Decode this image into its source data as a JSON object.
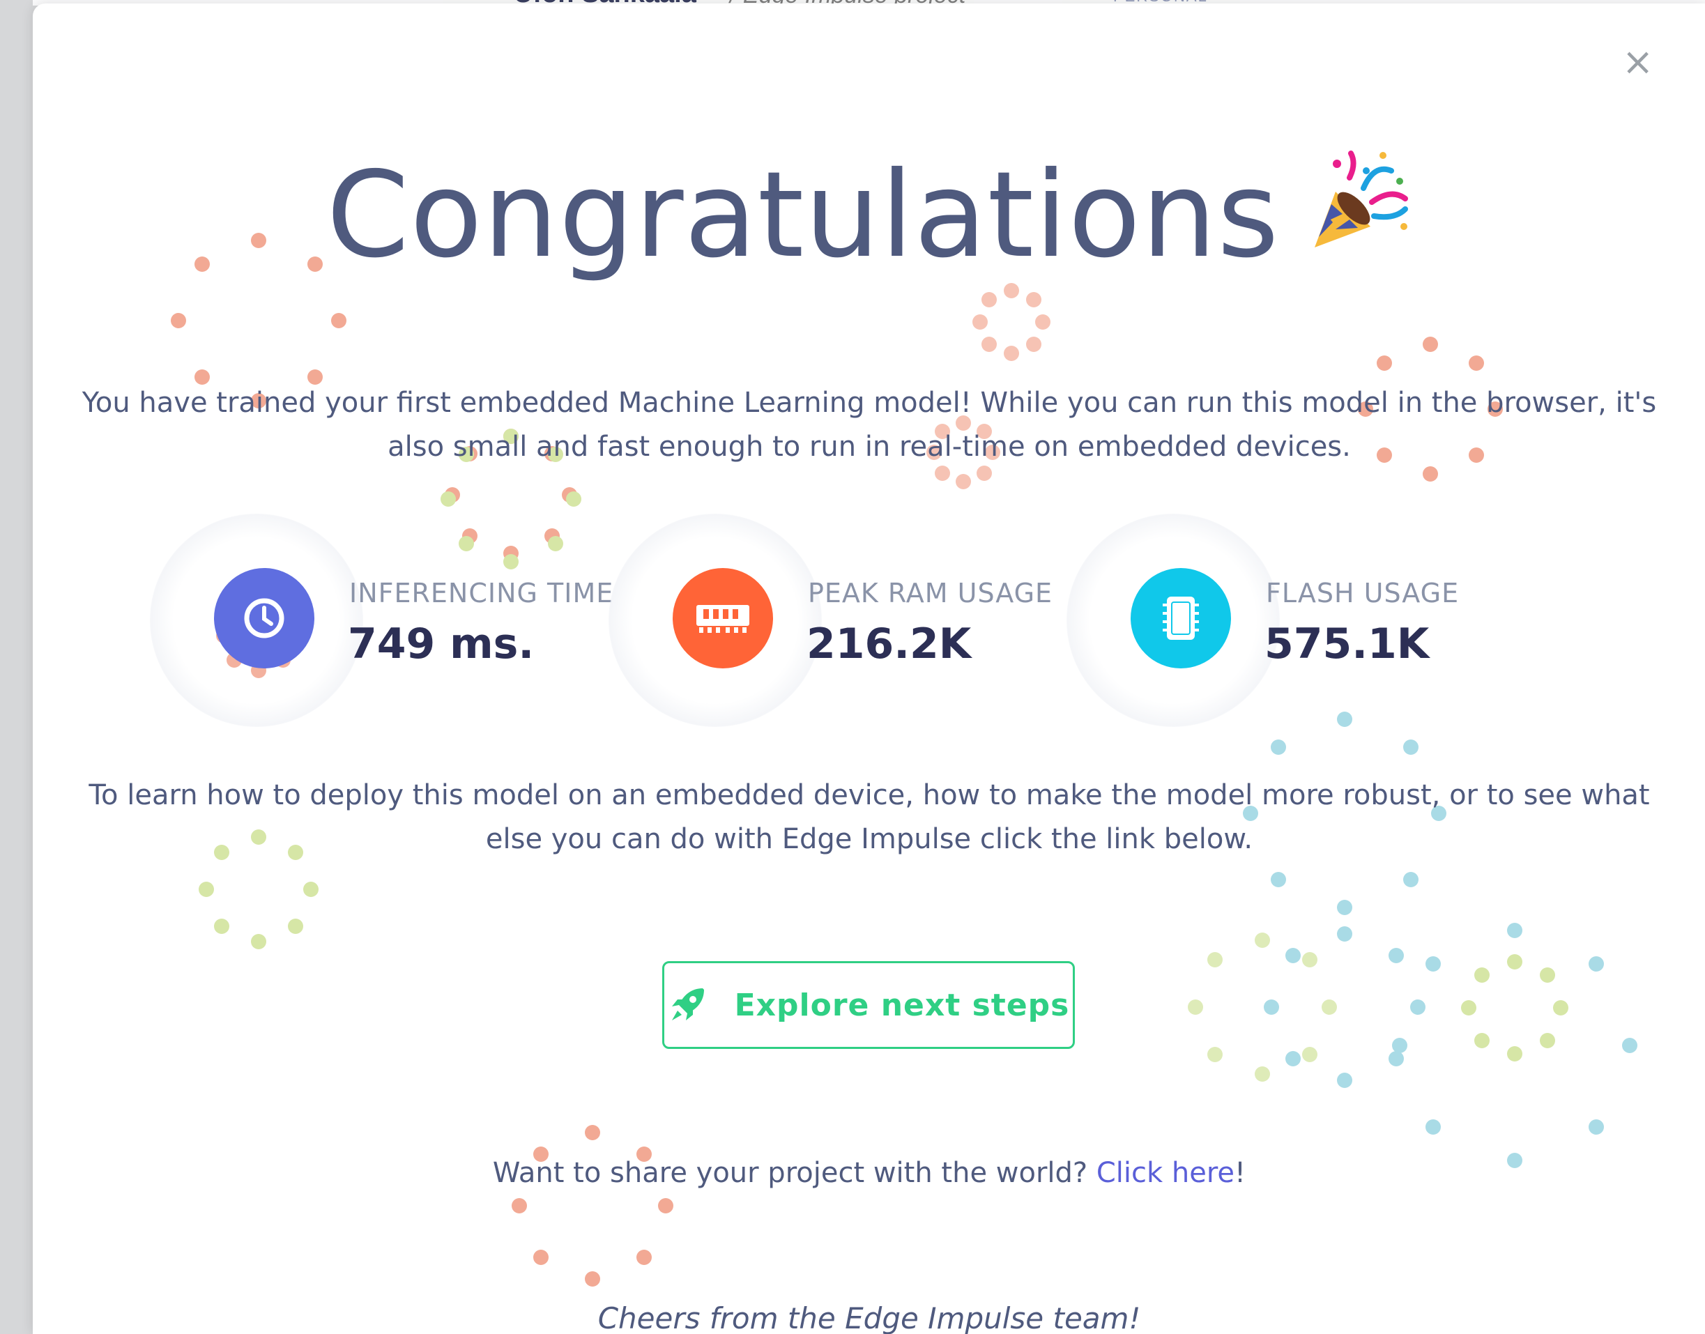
{
  "background": {
    "header_name": "Ufon Sankaala",
    "header_project": "/ Edge Impulse project",
    "header_badge": "PERSONAL"
  },
  "modal": {
    "close_label": "×",
    "title": "Congratulations",
    "title_icon": "party-popper-icon",
    "intro": "You have trained your first embedded Machine Learning model! While you can run this model in the browser, it's also small and fast enough to run in real-time on embedded devices.",
    "stats": [
      {
        "label": "INFERENCING TIME",
        "value": "749 ms.",
        "icon": "clock-icon",
        "color": "#5f6ee0"
      },
      {
        "label": "PEAK RAM USAGE",
        "value": "216.2K",
        "icon": "ram-icon",
        "color": "#ff6437"
      },
      {
        "label": "FLASH USAGE",
        "value": "575.1K",
        "icon": "chip-icon",
        "color": "#10c8ea"
      }
    ],
    "deploy_text": "To learn how to deploy this model on an embedded device, how to make the model more robust, or to see what else you can do with Edge Impulse click the link below.",
    "cta_label": "Explore next steps",
    "share_prefix": "Want to share your project with the world? ",
    "share_link": "Click here",
    "share_suffix": "!",
    "cheers": "Cheers from the Edge Impulse team!"
  },
  "colors": {
    "accent_green": "#2fcf84",
    "text": "#4f5a7e",
    "link": "#5a5fd8",
    "confetti_orange": "#f2a994",
    "confetti_green": "#d6e6a6",
    "confetti_blue": "#a9dbe6"
  }
}
